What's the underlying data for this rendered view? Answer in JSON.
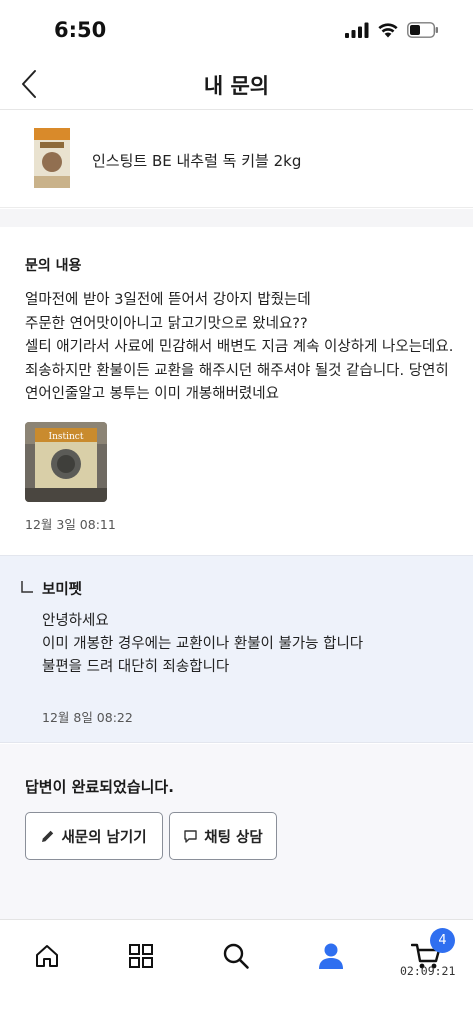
{
  "status_bar": {
    "time": "6:50"
  },
  "nav": {
    "title": "내 문의"
  },
  "product": {
    "name": "인스팅트 BE 내추럴 독 키블 2kg"
  },
  "inquiry": {
    "heading": "문의 내용",
    "body": "얼마전에 받아 3일전에 뜯어서 강아지 밥줬는데\n주문한 연어맛이아니고 닭고기맛으로 왔네요??\n셀티 애기라서 사료에 민감해서 배변도 지금 계속 이상하게 나오는데요. 죄송하지만 환불이든 교환을 해주시던 해주셔야 될것 같습니다. 당연히 연어인줄알고 봉투는 이미 개봉해버렸네요",
    "date": "12월 3일 08:11",
    "photo_brand": "Instinct"
  },
  "answer": {
    "author": "보미펫",
    "body": "안녕하세요\n이미 개봉한 경우에는 교환이나 환불이 불가능 합니다\n불편을 드려 대단히 죄송합니다",
    "date": "12월 8일 08:22"
  },
  "done": {
    "text": "답변이 완료되었습니다.",
    "new_inquiry_label": "새문의 남기기",
    "chat_label": "채팅 상담"
  },
  "tab_bar": {
    "items": [
      "home-icon",
      "categories-icon",
      "search-icon",
      "profile-icon",
      "cart-icon"
    ],
    "active": "profile-icon",
    "cart_count": "4",
    "timer": "02:09:21"
  },
  "colors": {
    "accent": "#2f6ff0",
    "answer_bg": "#eef2fa"
  }
}
